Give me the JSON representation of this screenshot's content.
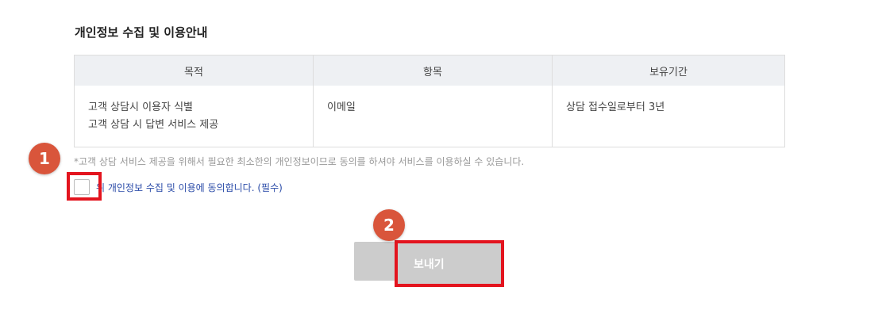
{
  "section": {
    "title": "개인정보 수집 및 이용안내"
  },
  "table": {
    "headers": [
      "목적",
      "항목",
      "보유기간"
    ],
    "row": {
      "purpose_line1": "고객 상담시 이용자 식별",
      "purpose_line2": "고객 상담 시 답변 서비스 제공",
      "item": "이메일",
      "period": "상담 접수일로부터 3년"
    }
  },
  "notice": "*고객 상담 서비스 제공을 위해서 필요한 최소한의 개인정보이므로 동의를 하셔야 서비스를 이용하실 수 있습니다.",
  "agree": {
    "label": "위 개인정보 수집 및 이용에 동의합니다. (필수)",
    "checked": false
  },
  "send_button": {
    "label": "보내기"
  },
  "callouts": {
    "one": "1",
    "two": "2"
  },
  "colors": {
    "callout_red": "#e3141e",
    "badge_orange": "#d9553b",
    "link_blue": "#2a4ba8"
  }
}
